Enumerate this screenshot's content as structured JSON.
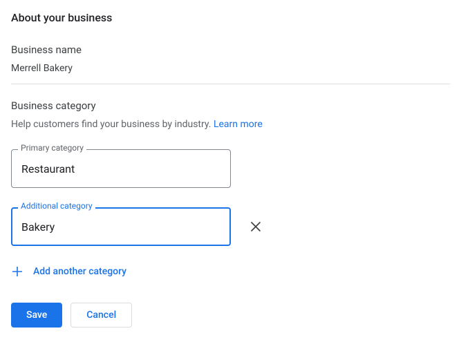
{
  "page_title": "About your business",
  "business_name": {
    "label": "Business name",
    "value": "Merrell Bakery"
  },
  "business_category": {
    "label": "Business category",
    "help_text": "Help customers find your business by industry. ",
    "learn_more": "Learn more"
  },
  "primary_category": {
    "legend": "Primary category",
    "value": "Restaurant"
  },
  "additional_category": {
    "legend": "Additional category",
    "value": "Bakery"
  },
  "add_another": "Add another category",
  "buttons": {
    "save": "Save",
    "cancel": "Cancel"
  }
}
